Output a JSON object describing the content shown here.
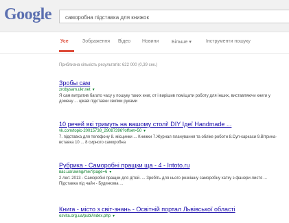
{
  "header": {
    "logo": "Google",
    "query": "саморобна підставка для книжок"
  },
  "tabs": [
    {
      "label": "Усе",
      "active": true
    },
    {
      "label": "Зображення"
    },
    {
      "label": "Відео"
    },
    {
      "label": "Новини"
    },
    {
      "label": "Більше ▾"
    },
    {
      "label": "Інструменти пошуку"
    }
  ],
  "stats": "Приблизна кількість результатів: 622 000 (0,39 сек.)",
  "results": [
    {
      "title": "Зробы сам",
      "url": "zrobysam.ukr.net",
      "snippet": "Я сам витратив багато часу у пошуку таких книг, от і вирішив поміщати роботу для інших, виставляючи книги у домену ... цікаві підставки своїми руками"
    },
    {
      "title": "10 речей які тримуть на вашому столі! DIY Ідеї Handmade ...",
      "url": "vk.com/topic-20015738_29087396?offset=50",
      "snippet": "7. підставка для телефону 8. місцинки ... Книжки 7.Журнал планування та облікe роботи 8.Суп-каркаси 9.Вітрина-вставка 10 ... 8 сирного саморобна"
    },
    {
      "title": "Рубрика - Саморобні пращки ща - 4 - Intoto.ru",
      "url": "вас.ua/uwing/me/?page=6",
      "snippet": "2 лют. 2013 - Саморобні пращки для дітей. ... Зробіть для нього розкішну саморобну хатку з фанери листя ... Підставка під чайн - Будинкова ..."
    },
    {
      "title": "Книга - місто з світ-знань - Освітній портал Львівської області",
      "url": "osvita.org.ua/publ/index.php",
      "snippet": ""
    }
  ]
}
